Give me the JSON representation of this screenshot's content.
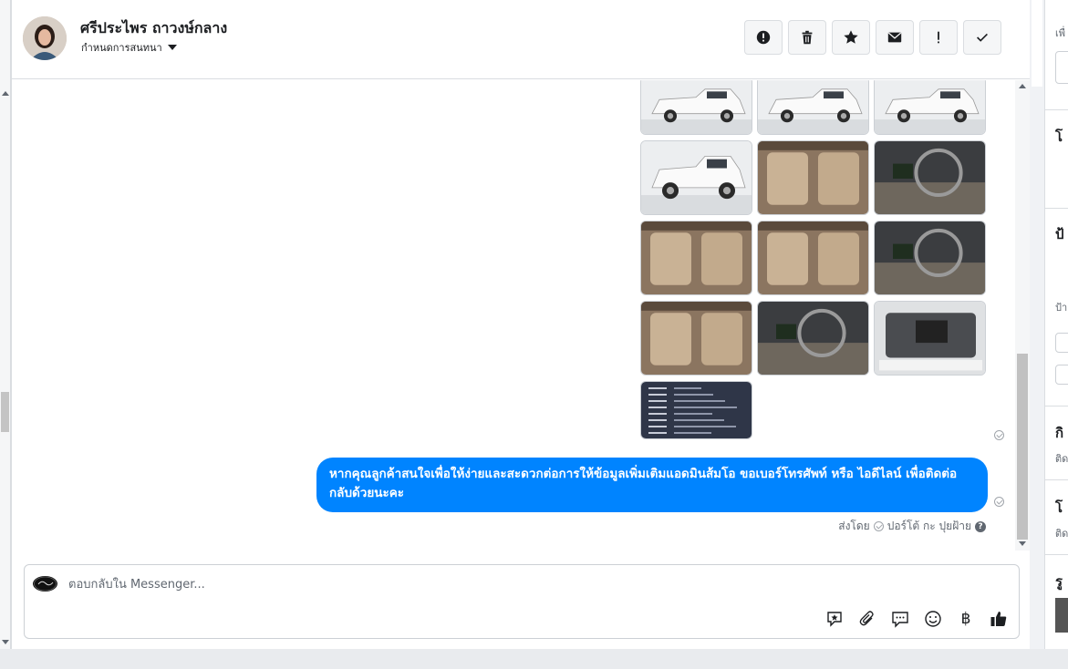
{
  "header": {
    "contact_name": "ศรีประไพร ถาวงษ์กลาง",
    "assign_label": "กำหนดการสนทนา"
  },
  "toolbar": {
    "buttons": [
      {
        "icon": "alert-circle-icon",
        "label": "!"
      },
      {
        "icon": "trash-icon",
        "label": ""
      },
      {
        "icon": "star-icon",
        "label": ""
      },
      {
        "icon": "envelope-icon",
        "label": ""
      },
      {
        "icon": "exclamation-icon",
        "label": "!"
      },
      {
        "icon": "check-icon",
        "label": ""
      }
    ]
  },
  "messages": {
    "photo_count": 13,
    "reply_text": "หากคุณลูกค้าสนใจเพื่อให้ง่ายและสะดวกต่อการให้ข้อมูลเพิ่มเติมแอดมินส้มโอ ขอเบอร์โทรศัพท์ หรือ ไอดีไลน์ เพื่อติดต่อกลับด้วยนะคะ",
    "sent_by_prefix": "ส่งโดย",
    "sent_by_name": "ปอร์โต้ กะ ปุยฝ้าย",
    "help_mark": "?"
  },
  "composer": {
    "placeholder": "ตอบกลับใน Messenger...",
    "tools": [
      "saved-reply-icon",
      "attach-icon",
      "chat-bubble-icon",
      "emoji-icon",
      "baht-icon",
      "thumbs-up-icon"
    ],
    "baht_symbol": "฿"
  },
  "sidebar": {
    "headings": [
      "โ",
      "ป้",
      "กิ",
      "โ",
      "รู"
    ],
    "subs": [
      "เพื่",
      "ป้า",
      "ติด",
      "ติด"
    ]
  },
  "colors": {
    "bubble": "#0084ff",
    "panel_bg": "#ffffff",
    "page_bg": "#e9ebee"
  }
}
